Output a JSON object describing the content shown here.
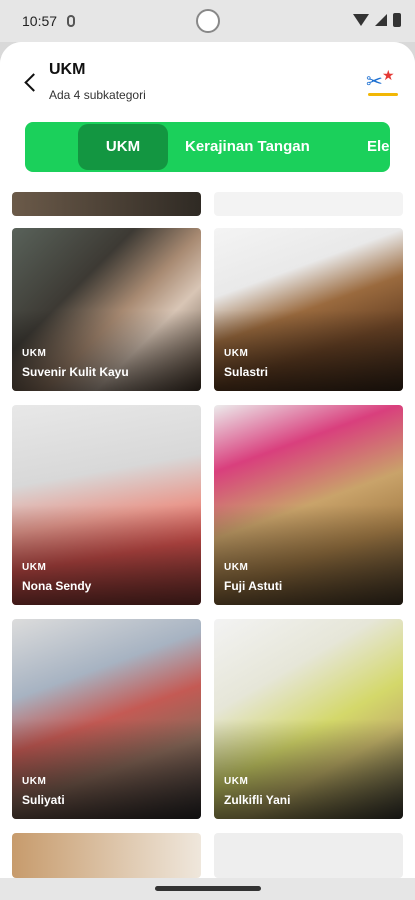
{
  "status_bar": {
    "time": "10:57"
  },
  "header": {
    "title": "UKM",
    "subtitle": "Ada 4 subkategori"
  },
  "tabs": [
    {
      "label": "UKM",
      "active": true
    },
    {
      "label": "Kerajinan Tangan",
      "active": false
    },
    {
      "label": "Elel",
      "active": false
    }
  ],
  "cards": [
    {
      "category": "UKM",
      "name": "Suvenir Kulit Kayu"
    },
    {
      "category": "UKM",
      "name": "Sulastri"
    },
    {
      "category": "UKM",
      "name": "Nona Sendy"
    },
    {
      "category": "UKM",
      "name": "Fuji Astuti"
    },
    {
      "category": "UKM",
      "name": "Suliyati"
    },
    {
      "category": "UKM",
      "name": "Zulkifli Yani"
    }
  ],
  "colors": {
    "tab_bar": "#1bd05b",
    "tab_active": "#139641"
  }
}
